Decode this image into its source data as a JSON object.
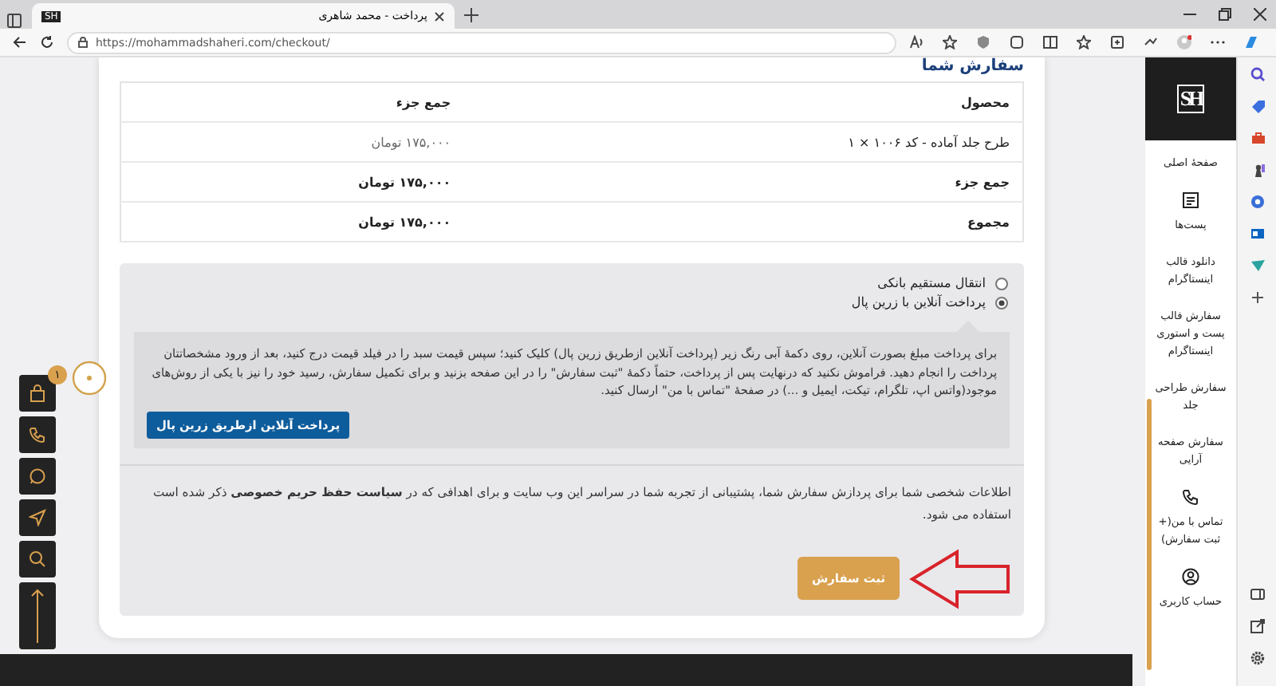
{
  "browser": {
    "favicon": "SH",
    "tab_title": "پرداخت - محمد شاهری",
    "url": "https://mohammadshaheri.com/checkout/"
  },
  "heading": "سفارش شما",
  "order_table": {
    "columns": [
      "محصول",
      "جمع جزء"
    ],
    "rows": [
      {
        "kind": "item",
        "label": "طرح جلد آماده - کد ۱۰۰۶ × ۱",
        "value": "۱۷۵,۰۰۰ تومان"
      },
      {
        "kind": "total",
        "label": "جمع جزء",
        "value": "۱۷۵,۰۰۰ تومان"
      },
      {
        "kind": "total",
        "label": "مجموع",
        "value": "۱۷۵,۰۰۰ تومان"
      }
    ]
  },
  "payment_methods": [
    {
      "label": "انتقال مستقیم بانکی",
      "selected": false
    },
    {
      "label": "پرداخت آنلاین با زرین پال",
      "selected": true
    }
  ],
  "payment_description": "برای پرداخت مبلغ بصورت آنلاین، روی دکمهٔ آبی رنگ زیر (پرداخت آنلاین ازطریق زرین پال) کلیک کنید؛ سپس قیمت سبد را در فیلد قیمت درج کنید، بعد از ورود مشخصاتتان پرداخت را انجام دهید. فراموش نکنید که درنهایت پس از پرداخت، حتماً دکمهٔ \"ثبت سفارش\" را در این صفحه بزنید و برای تکمیل سفارش، رسید خود را نیز با یکی از روش‌های موجود(واتس اپ، تلگرام، تیکت، ایمیل و ...) در صفحهٔ \"تماس با من\" ارسال کنید.",
  "pay_button": "پرداخت آنلاین ازطریق زرین پال",
  "privacy_text": "اطلاعات شخصی شما برای پردازش سفارش شما، پشتیبانی از تجربه شما در سراسر این وب سایت و برای اهدافی که در **سیاست حفظ حریم خصوصی** ذکر شده است استفاده می شود.",
  "submit_button": "ثبت سفارش",
  "cart_count": "۱",
  "logo": "SH",
  "sidebar_items": [
    {
      "kind": "text",
      "label": "صفحهٔ اصلی"
    },
    {
      "kind": "document",
      "label": "پست‌ها"
    },
    {
      "kind": "text",
      "label": "دانلود قالب اینستاگرام"
    },
    {
      "kind": "text",
      "label": "سفارش قالب پست و استوری اینستاگرام"
    },
    {
      "kind": "text",
      "label": "سفارش طراحی جلد"
    },
    {
      "kind": "text",
      "label": "سفارش صفحه آرایی"
    },
    {
      "kind": "phone",
      "label": "تماس با من(+ ثبت سفارش)"
    },
    {
      "kind": "user",
      "label": "حساب کاربری"
    }
  ]
}
